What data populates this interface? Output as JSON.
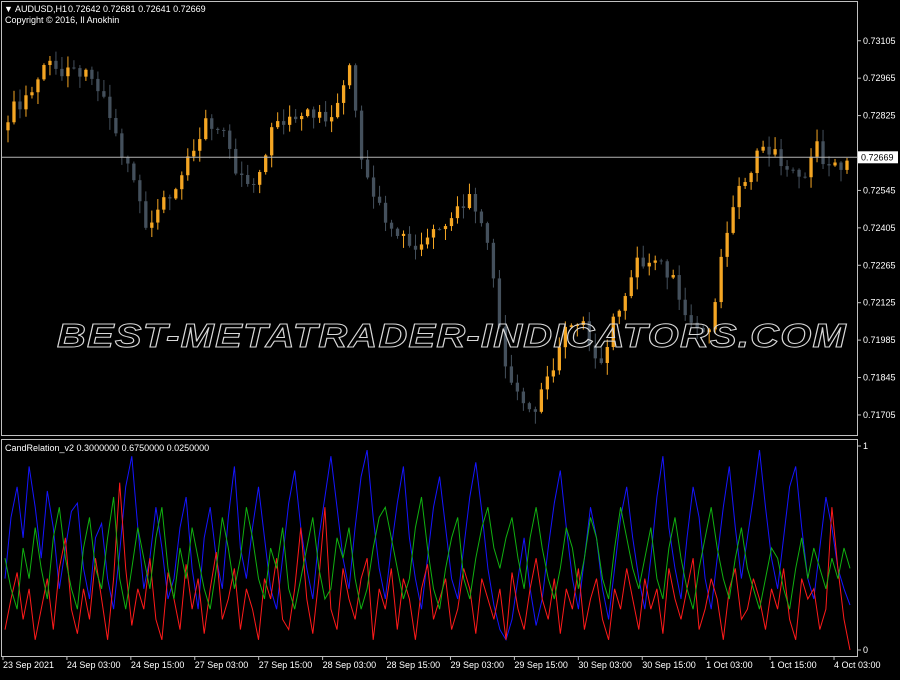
{
  "header": {
    "symbol": "AUDUSD,H1",
    "ohlc": "0.72642 0.72681 0.72641 0.72669",
    "copyright": "Copyright © 2016, Il Anokhin"
  },
  "watermark": "BEST-METATRADER-INDICATORS.COM",
  "indicator": {
    "title": "CandRelation_v2 0.3000000 0.6750000 0.0250000"
  },
  "colors": {
    "background": "#000000",
    "frame": "#c0c0c0",
    "bull": "#f5a623",
    "bear": "#44505c",
    "price_line": "#b4b4b4",
    "line_blue": "#1515ff",
    "line_red": "#ff1a1a",
    "line_green": "#10b010"
  },
  "chart_data": [
    {
      "type": "candlestick",
      "current_price": "0.72669",
      "ylim": [
        0.7163,
        0.7325
      ],
      "y_ticks": [
        "0.73105",
        "0.72965",
        "0.72825",
        "0.72685",
        "0.72545",
        "0.72405",
        "0.72265",
        "0.72125",
        "0.71985",
        "0.71845",
        "0.71705"
      ],
      "anchors": [
        [
          0,
          0.7283
        ],
        [
          4,
          0.7292
        ],
        [
          7,
          0.7305
        ],
        [
          9,
          0.7297
        ],
        [
          12,
          0.7299
        ],
        [
          15,
          0.7292
        ],
        [
          17,
          0.7282
        ],
        [
          19,
          0.7268
        ],
        [
          21,
          0.7258
        ],
        [
          23,
          0.7241
        ],
        [
          26,
          0.7252
        ],
        [
          28,
          0.7257
        ],
        [
          31,
          0.7268
        ],
        [
          33,
          0.7282
        ],
        [
          36,
          0.7274
        ],
        [
          38,
          0.7261
        ],
        [
          41,
          0.7254
        ],
        [
          44,
          0.7277
        ],
        [
          47,
          0.7282
        ],
        [
          50,
          0.7286
        ],
        [
          53,
          0.728
        ],
        [
          55,
          0.7285
        ],
        [
          57,
          0.7303
        ],
        [
          59,
          0.7268
        ],
        [
          62,
          0.7248
        ],
        [
          65,
          0.724
        ],
        [
          68,
          0.7233
        ],
        [
          71,
          0.724
        ],
        [
          74,
          0.7246
        ],
        [
          77,
          0.7252
        ],
        [
          79,
          0.7245
        ],
        [
          81,
          0.7222
        ],
        [
          83,
          0.719
        ],
        [
          86,
          0.7175
        ],
        [
          88,
          0.7172
        ],
        [
          90,
          0.7183
        ],
        [
          93,
          0.7202
        ],
        [
          96,
          0.7203
        ],
        [
          99,
          0.719
        ],
        [
          102,
          0.7212
        ],
        [
          105,
          0.7227
        ],
        [
          108,
          0.7227
        ],
        [
          111,
          0.7222
        ],
        [
          114,
          0.7205
        ],
        [
          117,
          0.72
        ],
        [
          120,
          0.724
        ],
        [
          123,
          0.726
        ],
        [
          126,
          0.7272
        ],
        [
          129,
          0.7265
        ],
        [
          132,
          0.7258
        ],
        [
          135,
          0.7271
        ],
        [
          137,
          0.7262
        ],
        [
          139,
          0.7264
        ],
        [
          140,
          0.7266
        ]
      ],
      "series": [
        {
          "name": "",
          "color": "#1515ff",
          "values": [
            0.35,
            0.65,
            0.8,
            0.55,
            0.9,
            0.7,
            0.45,
            0.78,
            0.6,
            0.3,
            0.5,
            0.68,
            0.72,
            0.4,
            0.25,
            0.55,
            0.62,
            0.35,
            0.2,
            0.48,
            0.8,
            0.95,
            0.6,
            0.3,
            0.45,
            0.7,
            0.5,
            0.25,
            0.35,
            0.6,
            0.75,
            0.4,
            0.2,
            0.55,
            0.7,
            0.45,
            0.3,
            0.65,
            0.9,
            0.5,
            0.35,
            0.6,
            0.8,
            0.55,
            0.3,
            0.2,
            0.45,
            0.72,
            0.88,
            0.6,
            0.4,
            0.25,
            0.55,
            0.75,
            0.95,
            0.7,
            0.45,
            0.3,
            0.6,
            0.85,
            0.98,
            0.65,
            0.4,
            0.25,
            0.5,
            0.72,
            0.9,
            0.55,
            0.35,
            0.2,
            0.45,
            0.7,
            0.85,
            0.6,
            0.35,
            0.25,
            0.5,
            0.75,
            0.92,
            0.68,
            0.4,
            0.22,
            0.1,
            0.05,
            0.15,
            0.35,
            0.55,
            0.3,
            0.12,
            0.25,
            0.5,
            0.72,
            0.88,
            0.6,
            0.35,
            0.2,
            0.45,
            0.7,
            0.55,
            0.3,
            0.15,
            0.4,
            0.65,
            0.8,
            0.55,
            0.35,
            0.2,
            0.45,
            0.75,
            0.95,
            0.6,
            0.4,
            0.25,
            0.55,
            0.8,
            0.65,
            0.35,
            0.2,
            0.45,
            0.7,
            0.9,
            0.6,
            0.35,
            0.55,
            0.75,
            0.98,
            0.7,
            0.45,
            0.3,
            0.55,
            0.8,
            0.9,
            0.6,
            0.35,
            0.25,
            0.5,
            0.75,
            0.6,
            0.4,
            0.3,
            0.22
          ]
        },
        {
          "name": "",
          "color": "#ff1a1a",
          "values": [
            0.1,
            0.25,
            0.38,
            0.15,
            0.3,
            0.05,
            0.2,
            0.35,
            0.1,
            0.4,
            0.55,
            0.2,
            0.08,
            0.3,
            0.15,
            0.45,
            0.25,
            0.05,
            0.35,
            0.82,
            0.4,
            0.12,
            0.3,
            0.2,
            0.45,
            0.15,
            0.05,
            0.38,
            0.25,
            0.1,
            0.42,
            0.2,
            0.35,
            0.08,
            0.3,
            0.48,
            0.15,
            0.25,
            0.4,
            0.1,
            0.3,
            0.2,
            0.05,
            0.35,
            0.25,
            0.45,
            0.15,
            0.1,
            0.3,
            0.6,
            0.25,
            0.08,
            0.35,
            0.7,
            0.2,
            0.1,
            0.4,
            0.25,
            0.15,
            0.35,
            0.45,
            0.05,
            0.3,
            0.2,
            0.4,
            0.1,
            0.35,
            0.25,
            0.05,
            0.3,
            0.42,
            0.15,
            0.25,
            0.35,
            0.1,
            0.2,
            0.4,
            0.3,
            0.08,
            0.35,
            0.25,
            0.15,
            0.3,
            0.05,
            0.38,
            0.2,
            0.1,
            0.3,
            0.45,
            0.25,
            0.15,
            0.35,
            0.08,
            0.3,
            0.2,
            0.4,
            0.1,
            0.25,
            0.35,
            0.15,
            0.05,
            0.3,
            0.2,
            0.4,
            0.25,
            0.1,
            0.35,
            0.2,
            0.3,
            0.08,
            0.4,
            0.25,
            0.15,
            0.3,
            0.45,
            0.1,
            0.2,
            0.35,
            0.25,
            0.05,
            0.3,
            0.4,
            0.15,
            0.2,
            0.35,
            0.25,
            0.1,
            0.3,
            0.2,
            0.4,
            0.15,
            0.05,
            0.35,
            0.25,
            0.3,
            0.1,
            0.2,
            0.7,
            0.4,
            0.15,
            0.0
          ]
        },
        {
          "name": "",
          "color": "#10b010",
          "values": [
            0.45,
            0.3,
            0.2,
            0.5,
            0.35,
            0.6,
            0.4,
            0.25,
            0.55,
            0.7,
            0.45,
            0.3,
            0.2,
            0.5,
            0.65,
            0.4,
            0.3,
            0.55,
            0.75,
            0.35,
            0.2,
            0.4,
            0.6,
            0.45,
            0.3,
            0.55,
            0.7,
            0.4,
            0.25,
            0.5,
            0.35,
            0.6,
            0.45,
            0.3,
            0.2,
            0.4,
            0.65,
            0.5,
            0.3,
            0.45,
            0.7,
            0.55,
            0.35,
            0.25,
            0.5,
            0.4,
            0.6,
            0.3,
            0.2,
            0.35,
            0.5,
            0.65,
            0.4,
            0.25,
            0.3,
            0.55,
            0.45,
            0.6,
            0.35,
            0.2,
            0.3,
            0.5,
            0.65,
            0.7,
            0.55,
            0.4,
            0.25,
            0.35,
            0.6,
            0.75,
            0.5,
            0.3,
            0.2,
            0.4,
            0.55,
            0.65,
            0.35,
            0.25,
            0.45,
            0.6,
            0.7,
            0.5,
            0.4,
            0.55,
            0.65,
            0.45,
            0.3,
            0.55,
            0.7,
            0.5,
            0.35,
            0.25,
            0.4,
            0.6,
            0.5,
            0.3,
            0.45,
            0.65,
            0.55,
            0.35,
            0.25,
            0.5,
            0.7,
            0.55,
            0.4,
            0.3,
            0.45,
            0.6,
            0.35,
            0.25,
            0.5,
            0.65,
            0.45,
            0.3,
            0.2,
            0.4,
            0.55,
            0.7,
            0.5,
            0.35,
            0.25,
            0.45,
            0.6,
            0.4,
            0.3,
            0.2,
            0.35,
            0.5,
            0.45,
            0.3,
            0.2,
            0.4,
            0.55,
            0.35,
            0.5,
            0.4,
            0.3,
            0.45,
            0.35,
            0.5,
            0.4
          ]
        }
      ],
      "sub_ylim": [
        0,
        1
      ],
      "sub_y_ticks": [
        "1",
        "0"
      ],
      "x_ticks": [
        "23 Sep 2021",
        "24 Sep 03:00",
        "24 Sep 15:00",
        "27 Sep 03:00",
        "27 Sep 15:00",
        "28 Sep 03:00",
        "28 Sep 15:00",
        "29 Sep 03:00",
        "29 Sep 15:00",
        "30 Sep 03:00",
        "30 Sep 15:00",
        "1 Oct 03:00",
        "1 Oct 15:00",
        "4 Oct 03:00"
      ]
    }
  ]
}
